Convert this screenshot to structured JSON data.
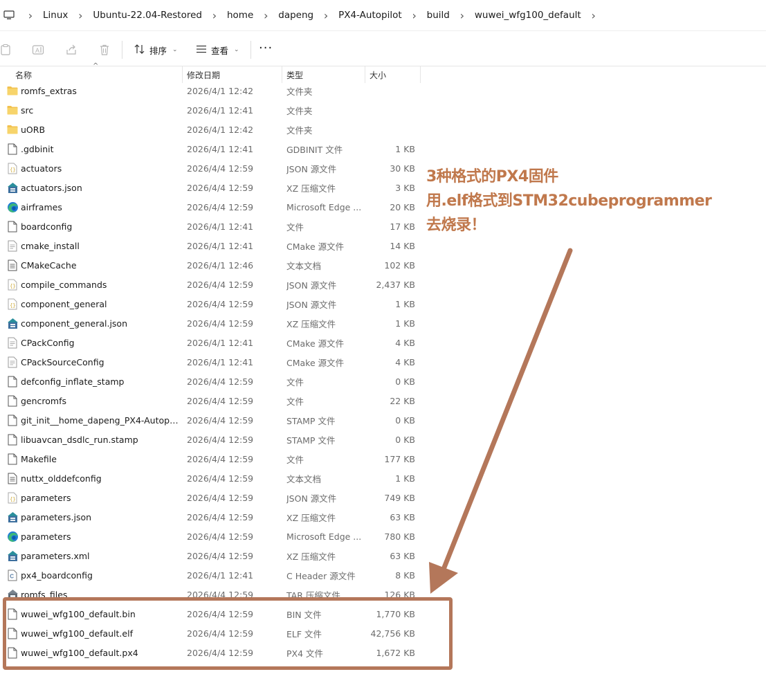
{
  "breadcrumb": [
    "Linux",
    "Ubuntu-22.04-Restored",
    "home",
    "dapeng",
    "PX4-Autopilot",
    "build",
    "wuwei_wfg100_default"
  ],
  "toolbar": {
    "sort_label": "排序",
    "view_label": "查看",
    "more_label": "···"
  },
  "columns": {
    "name": "名称",
    "modified": "修改日期",
    "type": "类型",
    "size": "大小"
  },
  "files": [
    {
      "icon": "folder-icon",
      "name": "romfs_extras",
      "date": "2026/4/1 12:42",
      "type": "文件夹",
      "size": ""
    },
    {
      "icon": "folder-icon",
      "name": "src",
      "date": "2026/4/1 12:41",
      "type": "文件夹",
      "size": ""
    },
    {
      "icon": "folder-icon",
      "name": "uORB",
      "date": "2026/4/1 12:42",
      "type": "文件夹",
      "size": ""
    },
    {
      "icon": "file-icon",
      "name": ".gdbinit",
      "date": "2026/4/1 12:41",
      "type": "GDBINIT 文件",
      "size": "1 KB"
    },
    {
      "icon": "json-icon",
      "name": "actuators",
      "date": "2026/4/4 12:59",
      "type": "JSON 源文件",
      "size": "30 KB"
    },
    {
      "icon": "xz-archive-icon",
      "name": "actuators.json",
      "date": "2026/4/4 12:59",
      "type": "XZ 压缩文件",
      "size": "3 KB"
    },
    {
      "icon": "edge-icon",
      "name": "airframes",
      "date": "2026/4/4 12:59",
      "type": "Microsoft Edge ...",
      "size": "20 KB"
    },
    {
      "icon": "file-icon",
      "name": "boardconfig",
      "date": "2026/4/1 12:41",
      "type": "文件",
      "size": "17 KB"
    },
    {
      "icon": "cmake-icon",
      "name": "cmake_install",
      "date": "2026/4/1 12:41",
      "type": "CMake 源文件",
      "size": "14 KB"
    },
    {
      "icon": "text-file-icon",
      "name": "CMakeCache",
      "date": "2026/4/1 12:46",
      "type": "文本文档",
      "size": "102 KB"
    },
    {
      "icon": "json-icon",
      "name": "compile_commands",
      "date": "2026/4/4 12:59",
      "type": "JSON 源文件",
      "size": "2,437 KB"
    },
    {
      "icon": "json-icon",
      "name": "component_general",
      "date": "2026/4/4 12:59",
      "type": "JSON 源文件",
      "size": "1 KB"
    },
    {
      "icon": "xz-archive-icon",
      "name": "component_general.json",
      "date": "2026/4/4 12:59",
      "type": "XZ 压缩文件",
      "size": "1 KB"
    },
    {
      "icon": "cmake-icon",
      "name": "CPackConfig",
      "date": "2026/4/1 12:41",
      "type": "CMake 源文件",
      "size": "4 KB"
    },
    {
      "icon": "cmake-icon",
      "name": "CPackSourceConfig",
      "date": "2026/4/1 12:41",
      "type": "CMake 源文件",
      "size": "4 KB"
    },
    {
      "icon": "file-icon",
      "name": "defconfig_inflate_stamp",
      "date": "2026/4/4 12:59",
      "type": "文件",
      "size": "0 KB"
    },
    {
      "icon": "file-icon",
      "name": "gencromfs",
      "date": "2026/4/4 12:59",
      "type": "文件",
      "size": "22 KB"
    },
    {
      "icon": "file-icon",
      "name": "git_init__home_dapeng_PX4-Autopilot...",
      "date": "2026/4/4 12:59",
      "type": "STAMP 文件",
      "size": "0 KB"
    },
    {
      "icon": "file-icon",
      "name": "libuavcan_dsdlc_run.stamp",
      "date": "2026/4/4 12:59",
      "type": "STAMP 文件",
      "size": "0 KB"
    },
    {
      "icon": "file-icon",
      "name": "Makefile",
      "date": "2026/4/4 12:59",
      "type": "文件",
      "size": "177 KB"
    },
    {
      "icon": "text-file-icon",
      "name": "nuttx_olddefconfig",
      "date": "2026/4/4 12:59",
      "type": "文本文档",
      "size": "1 KB"
    },
    {
      "icon": "json-icon",
      "name": "parameters",
      "date": "2026/4/4 12:59",
      "type": "JSON 源文件",
      "size": "749 KB"
    },
    {
      "icon": "xz-archive-icon",
      "name": "parameters.json",
      "date": "2026/4/4 12:59",
      "type": "XZ 压缩文件",
      "size": "63 KB"
    },
    {
      "icon": "edge-icon",
      "name": "parameters",
      "date": "2026/4/4 12:59",
      "type": "Microsoft Edge ...",
      "size": "780 KB"
    },
    {
      "icon": "xz-archive-icon",
      "name": "parameters.xml",
      "date": "2026/4/4 12:59",
      "type": "XZ 压缩文件",
      "size": "63 KB"
    },
    {
      "icon": "c-header-icon",
      "name": "px4_boardconfig",
      "date": "2026/4/1 12:41",
      "type": "C Header 源文件",
      "size": "8 KB"
    },
    {
      "icon": "tar-archive-icon",
      "name": "romfs_files",
      "date": "2026/4/4 12:59",
      "type": "TAR 压缩文件",
      "size": "126 KB"
    },
    {
      "icon": "file-icon",
      "name": "wuwei_wfg100_default.bin",
      "date": "2026/4/4 12:59",
      "type": "BIN 文件",
      "size": "1,770 KB"
    },
    {
      "icon": "file-icon",
      "name": "wuwei_wfg100_default.elf",
      "date": "2026/4/4 12:59",
      "type": "ELF 文件",
      "size": "42,756 KB"
    },
    {
      "icon": "file-icon",
      "name": "wuwei_wfg100_default.px4",
      "date": "2026/4/4 12:59",
      "type": "PX4 文件",
      "size": "1,672 KB"
    }
  ],
  "annotation": {
    "line1": "3种格式的PX4固件",
    "line2": "用.elf格式到STM32cubeprogrammer",
    "line3": "去烧录！",
    "color": "#c0784c"
  },
  "colors": {
    "folder": "#f2c14e",
    "highlight_box": "#b4775a",
    "edge_blue": "#1f7ad9",
    "edge_green": "#3cb878"
  }
}
